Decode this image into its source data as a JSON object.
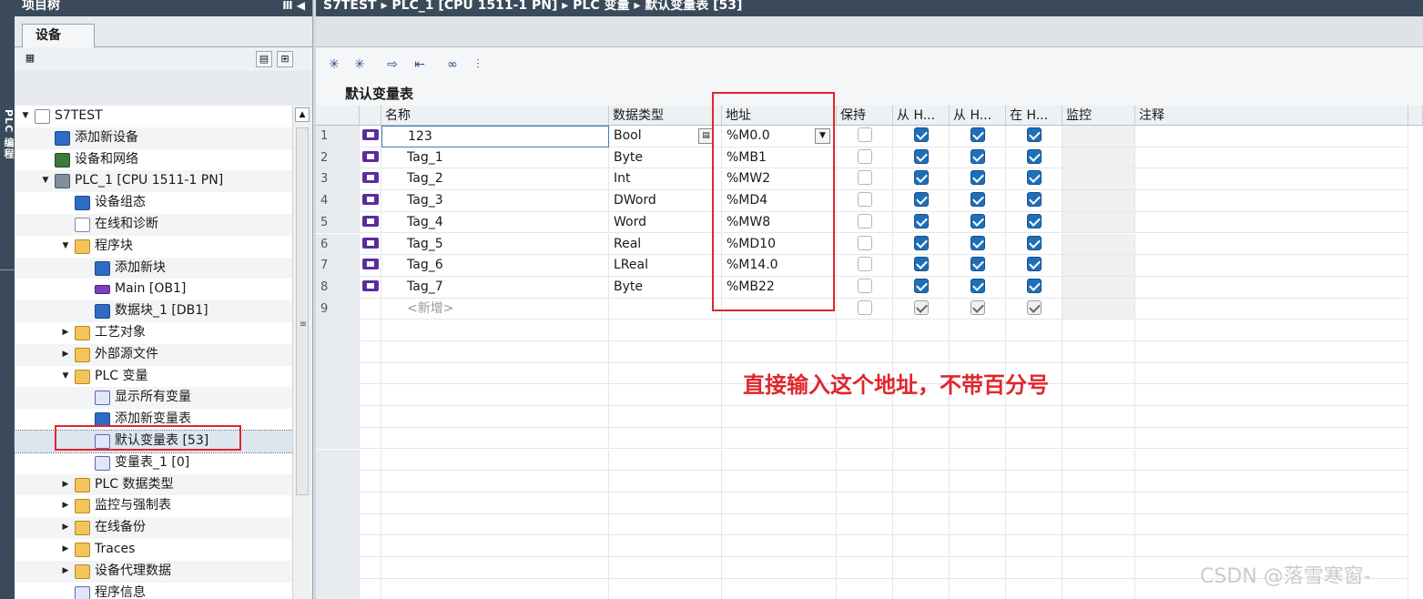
{
  "sidebar_strip": {
    "label": "PLC 编程"
  },
  "tree_panel": {
    "title": "项目树",
    "header_buttons": "Ⅲ ◀",
    "tab": "设备",
    "items": [
      {
        "label": "S7TEST",
        "toggle": "▼",
        "icon": "project-icon"
      },
      {
        "label": "添加新设备",
        "toggle": "",
        "icon": "add-device-icon"
      },
      {
        "label": "设备和网络",
        "toggle": "",
        "icon": "network-icon"
      },
      {
        "label": "PLC_1 [CPU 1511-1 PN]",
        "toggle": "▼",
        "icon": "plc-icon"
      },
      {
        "label": "设备组态",
        "toggle": "",
        "icon": "device-config-icon"
      },
      {
        "label": "在线和诊断",
        "toggle": "",
        "icon": "online-diagnostics-icon"
      },
      {
        "label": "程序块",
        "toggle": "▼",
        "icon": "folder-icon"
      },
      {
        "label": "添加新块",
        "toggle": "",
        "icon": "add-block-icon"
      },
      {
        "label": "Main [OB1]",
        "toggle": "",
        "icon": "ob-block-icon"
      },
      {
        "label": "数据块_1 [DB1]",
        "toggle": "",
        "icon": "db-block-icon"
      },
      {
        "label": "工艺对象",
        "toggle": "▶",
        "icon": "folder-icon"
      },
      {
        "label": "外部源文件",
        "toggle": "▶",
        "icon": "folder-icon"
      },
      {
        "label": "PLC 变量",
        "toggle": "▼",
        "icon": "folder-icon"
      },
      {
        "label": "显示所有变量",
        "toggle": "",
        "icon": "show-tags-icon"
      },
      {
        "label": "添加新变量表",
        "toggle": "",
        "icon": "add-tag-table-icon"
      },
      {
        "label": "默认变量表 [53]",
        "toggle": "",
        "icon": "tag-table-icon"
      },
      {
        "label": "变量表_1 [0]",
        "toggle": "",
        "icon": "tag-table-icon"
      },
      {
        "label": "PLC 数据类型",
        "toggle": "▶",
        "icon": "folder-icon"
      },
      {
        "label": "监控与强制表",
        "toggle": "▶",
        "icon": "folder-icon"
      },
      {
        "label": "在线备份",
        "toggle": "▶",
        "icon": "folder-icon"
      },
      {
        "label": "Traces",
        "toggle": "▶",
        "icon": "folder-icon"
      },
      {
        "label": "设备代理数据",
        "toggle": "▶",
        "icon": "folder-icon"
      },
      {
        "label": "程序信息",
        "toggle": "",
        "icon": "program-info-icon"
      }
    ]
  },
  "main": {
    "breadcrumb": "S7TEST ▸ PLC_1 [CPU 1511-1 PN] ▸ PLC 变量 ▸ 默认变量表 [53]",
    "table_title": "默认变量表",
    "columns": [
      "名称",
      "数据类型",
      "地址",
      "保持",
      "从 H...",
      "从 H...",
      "在 H...",
      "监控",
      "注释"
    ],
    "rows": [
      {
        "num": "1",
        "name": "123",
        "type": "Bool",
        "address": "%M0.0",
        "retain": false,
        "acc": true,
        "wri": true,
        "vis": true
      },
      {
        "num": "2",
        "name": "Tag_1",
        "type": "Byte",
        "address": "%MB1",
        "retain": false,
        "acc": true,
        "wri": true,
        "vis": true
      },
      {
        "num": "3",
        "name": "Tag_2",
        "type": "Int",
        "address": "%MW2",
        "retain": false,
        "acc": true,
        "wri": true,
        "vis": true
      },
      {
        "num": "4",
        "name": "Tag_3",
        "type": "DWord",
        "address": "%MD4",
        "retain": false,
        "acc": true,
        "wri": true,
        "vis": true
      },
      {
        "num": "5",
        "name": "Tag_4",
        "type": "Word",
        "address": "%MW8",
        "retain": false,
        "acc": true,
        "wri": true,
        "vis": true
      },
      {
        "num": "6",
        "name": "Tag_5",
        "type": "Real",
        "address": "%MD10",
        "retain": false,
        "acc": true,
        "wri": true,
        "vis": true
      },
      {
        "num": "7",
        "name": "Tag_6",
        "type": "LReal",
        "address": "%M14.0",
        "retain": false,
        "acc": true,
        "wri": true,
        "vis": true
      },
      {
        "num": "8",
        "name": "Tag_7",
        "type": "Byte",
        "address": "%MB22",
        "retain": false,
        "acc": true,
        "wri": true,
        "vis": true
      }
    ],
    "new_row": {
      "num": "9",
      "label": "<新增>"
    },
    "annotation": "直接输入这个地址，不带百分号",
    "watermark": "CSDN @落雪寒窗-"
  },
  "colors": {
    "accent": "#1f6fb8",
    "highlight": "#e0262c",
    "header_bar": "#3a4a5a"
  }
}
